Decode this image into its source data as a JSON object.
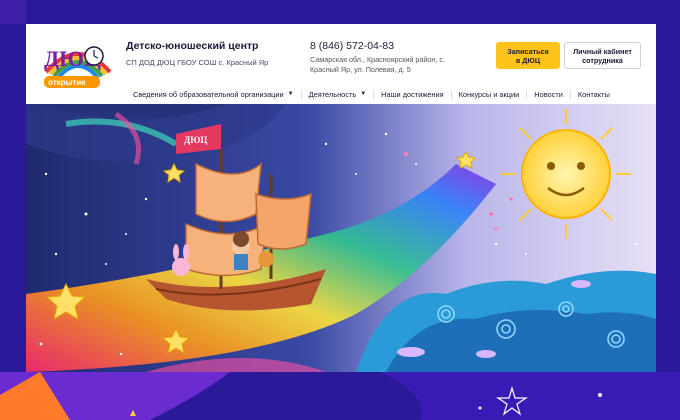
{
  "header": {
    "org_title": "Детско-юношеский центр",
    "org_subtitle": "СП ДОД ДЮЦ ГБОУ СОШ с. Красный Яр",
    "phone": "8 (846) 572-04-83",
    "address": "Самарская обл., Красноярский район, с. Красный Яр, ул. Полевая, д. 5",
    "enroll_button": "Записаться\nв ДЮЦ",
    "cabinet_button": "Личный кабинет\nсотрудника",
    "logo_text": "ДЮЦ",
    "logo_ribbon": "открытие"
  },
  "nav": {
    "items": [
      {
        "label": "Сведения об образовательной организации",
        "has_dropdown": true
      },
      {
        "label": "Деятельность",
        "has_dropdown": true
      },
      {
        "label": "Наши достижения",
        "has_dropdown": false
      },
      {
        "label": "Конкурсы и акции",
        "has_dropdown": false
      },
      {
        "label": "Новости",
        "has_dropdown": false
      },
      {
        "label": "Контакты",
        "has_dropdown": false
      }
    ]
  },
  "hero": {
    "flag_text": "ДЮЦ"
  },
  "colors": {
    "page_bg": "#2a1a9a",
    "accent_yellow": "#ffc41a",
    "text_dark": "#1b1b3a",
    "night_sky": "#23306f",
    "sun": "#ffd13b"
  }
}
